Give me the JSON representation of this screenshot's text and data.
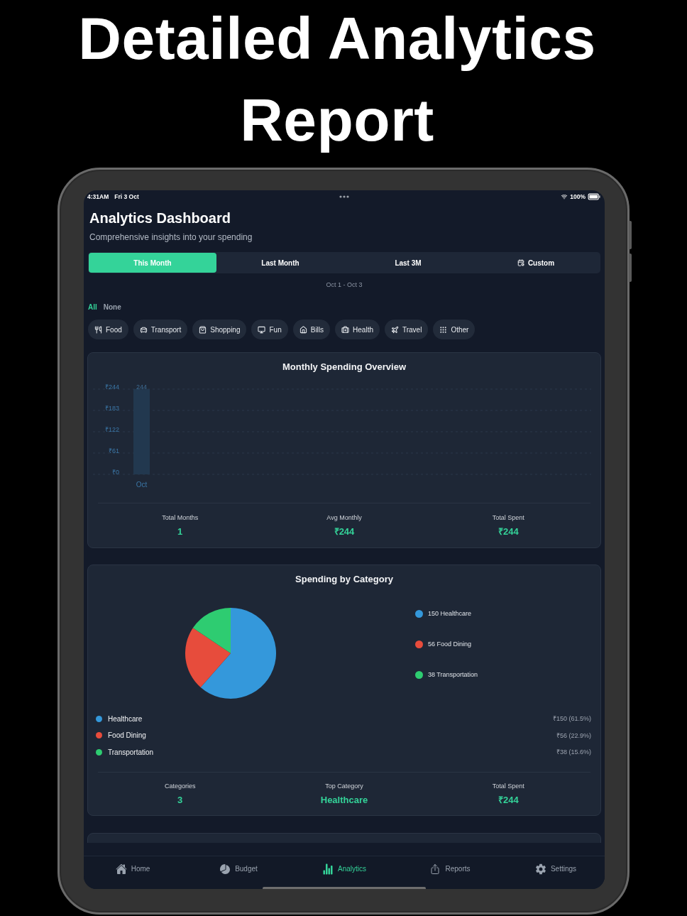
{
  "headline": "Detailed Analytics Report",
  "status_bar": {
    "time": "4:31AM",
    "date": "Fri 3 Oct",
    "battery": "100%"
  },
  "header": {
    "title": "Analytics Dashboard",
    "subtitle": "Comprehensive insights into your spending"
  },
  "period_tabs": [
    {
      "label": "This Month",
      "kind": "preset",
      "selected": true
    },
    {
      "label": "Last Month",
      "kind": "preset",
      "selected": false
    },
    {
      "label": "Last 3M",
      "kind": "preset",
      "selected": false
    },
    {
      "label": "Custom",
      "kind": "custom",
      "selected": false
    }
  ],
  "date_range": "Oct 1 - Oct 3",
  "quick_select": [
    {
      "label": "All",
      "selected": true
    },
    {
      "label": "None",
      "selected": false
    }
  ],
  "category_filters": [
    {
      "label": "Food",
      "kind": "food"
    },
    {
      "label": "Transport",
      "kind": "transport"
    },
    {
      "label": "Shopping",
      "kind": "shopping"
    },
    {
      "label": "Fun",
      "kind": "fun"
    },
    {
      "label": "Bills",
      "kind": "bills"
    },
    {
      "label": "Health",
      "kind": "health"
    },
    {
      "label": "Travel",
      "kind": "travel"
    },
    {
      "label": "Other",
      "kind": "other"
    }
  ],
  "monthly_overview": {
    "title": "Monthly Spending Overview",
    "chart_data": {
      "type": "bar",
      "categories": [
        "Oct"
      ],
      "series": [
        {
          "color": "#22384f",
          "values": [
            244
          ]
        }
      ],
      "ylim": [
        0,
        244
      ],
      "yticks": [
        {
          "value": 0,
          "label": "₹0"
        },
        {
          "value": 61,
          "label": "₹61"
        },
        {
          "value": 122,
          "label": "₹122"
        },
        {
          "value": 183,
          "label": "₹183"
        },
        {
          "value": 244,
          "label": "₹244"
        }
      ],
      "grid": true,
      "data_labels": true
    },
    "stats": [
      {
        "label": "Total Months",
        "value": "1"
      },
      {
        "label": "Avg Monthly",
        "value": "₹244"
      },
      {
        "label": "Total Spent",
        "value": "₹244"
      }
    ]
  },
  "category_breakdown": {
    "title": "Spending by Category",
    "chart_data": {
      "type": "pie",
      "categories": [
        "Healthcare",
        "Food Dining",
        "Transportation"
      ],
      "series": [
        {
          "values": [
            61.5,
            22.9,
            15.6
          ]
        }
      ]
    },
    "legend": [
      {
        "label": "150 Healthcare",
        "color": "#3498db"
      },
      {
        "label": "56 Food Dining",
        "color": "#e74c3c"
      },
      {
        "label": "38 Transportation",
        "color": "#2ecc71"
      }
    ],
    "items": [
      {
        "amount": "₹150 (61.5%)",
        "color": "#3498db"
      },
      {
        "amount": "₹56 (22.9%)",
        "color": "#e74c3c"
      },
      {
        "amount": "₹38 (15.6%)",
        "color": "#2ecc71"
      }
    ],
    "stats": [
      {
        "label": "Categories",
        "value": "3"
      },
      {
        "label": "Top Category",
        "value": "Healthcare"
      },
      {
        "label": "Total Spent",
        "value": "₹244"
      }
    ]
  },
  "bottom_nav": [
    {
      "label": "Home",
      "kind": "home",
      "selected": false
    },
    {
      "label": "Budget",
      "kind": "budget",
      "selected": false
    },
    {
      "label": "Analytics",
      "kind": "analytics",
      "selected": true
    },
    {
      "label": "Reports",
      "kind": "reports",
      "selected": false
    },
    {
      "label": "Settings",
      "kind": "settings",
      "selected": false
    }
  ]
}
